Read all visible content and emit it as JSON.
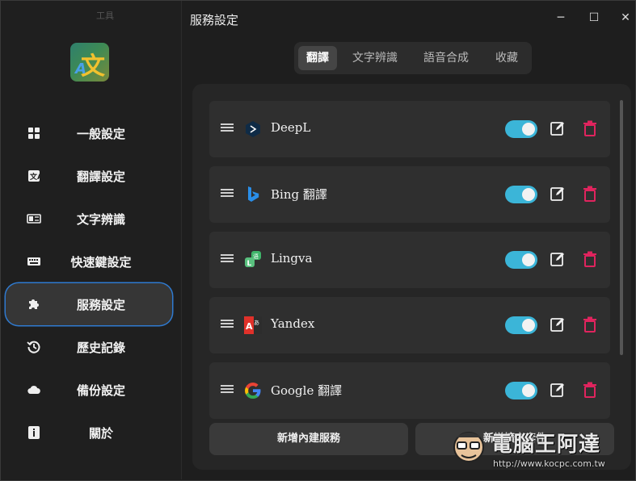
{
  "sidebar": {
    "top_label": "工具",
    "items": [
      {
        "label": "一般設定",
        "icon": "grid-icon"
      },
      {
        "label": "翻譯設定",
        "icon": "translate-icon"
      },
      {
        "label": "文字辨識",
        "icon": "ocr-icon"
      },
      {
        "label": "快速鍵設定",
        "icon": "keyboard-icon"
      },
      {
        "label": "服務設定",
        "icon": "puzzle-icon",
        "active": true
      },
      {
        "label": "歷史記錄",
        "icon": "history-icon"
      },
      {
        "label": "備份設定",
        "icon": "cloud-icon"
      },
      {
        "label": "關於",
        "icon": "info-icon"
      }
    ]
  },
  "window": {
    "title": "服務設定",
    "minimize": "─",
    "maximize": "☐",
    "close": "✕"
  },
  "tabs": [
    {
      "label": "翻譯",
      "active": true
    },
    {
      "label": "文字辨識"
    },
    {
      "label": "語音合成"
    },
    {
      "label": "收藏"
    }
  ],
  "services": [
    {
      "name": "DeepL",
      "logo": "deepl-logo",
      "enabled": true
    },
    {
      "name": "Bing 翻譯",
      "logo": "bing-logo",
      "enabled": true
    },
    {
      "name": "Lingva",
      "logo": "lingva-logo",
      "enabled": true
    },
    {
      "name": "Yandex",
      "logo": "yandex-logo",
      "enabled": true
    },
    {
      "name": "Google 翻譯",
      "logo": "google-logo",
      "enabled": true
    }
  ],
  "buttons": {
    "add_builtin": "新增內建服務",
    "add_plugin": "新增擴充套件"
  },
  "watermark": {
    "text": "電腦王阿達",
    "url": "http://www.kocpc.com.tw"
  },
  "colors": {
    "accent_toggle": "#3bb5d8",
    "delete_red": "#e0245e",
    "active_outline": "#2f7ad0"
  }
}
